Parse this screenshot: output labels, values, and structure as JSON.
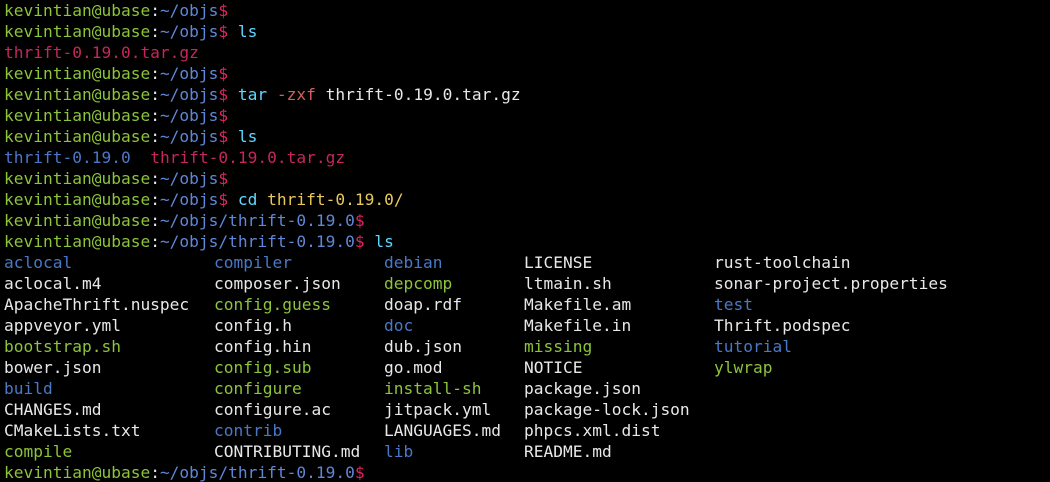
{
  "prompt": {
    "user_host": "kevintian@ubase",
    "separator": ":",
    "dollar": "$"
  },
  "history": [
    {
      "path": "~/objs",
      "command": null
    },
    {
      "path": "~/objs",
      "command": {
        "name": "ls",
        "args": []
      }
    },
    {
      "output": [
        {
          "text": "thrift-0.19.0.tar.gz",
          "type": "archive"
        }
      ]
    },
    {
      "path": "~/objs",
      "command": null
    },
    {
      "path": "~/objs",
      "command": {
        "name": "tar",
        "flag": "-zxf",
        "arg": "thrift-0.19.0.tar.gz"
      }
    },
    {
      "path": "~/objs",
      "command": null
    },
    {
      "path": "~/objs",
      "command": {
        "name": "ls",
        "args": []
      }
    },
    {
      "output": [
        {
          "text": "thrift-0.19.0",
          "type": "dir"
        },
        {
          "text": "thrift-0.19.0.tar.gz",
          "type": "archive"
        }
      ]
    },
    {
      "path": "~/objs",
      "command": null
    },
    {
      "path": "~/objs",
      "command": {
        "name": "cd",
        "arg": "thrift-0.19.0/"
      }
    },
    {
      "path": "~/objs/thrift-0.19.0",
      "command": null
    },
    {
      "path": "~/objs/thrift-0.19.0",
      "command": {
        "name": "ls",
        "args": []
      }
    }
  ],
  "lines": {
    "l0": {
      "path": "~/objs"
    },
    "l1": {
      "path": "~/objs",
      "cmd": "ls"
    },
    "l2": {
      "out": "thrift-0.19.0.tar.gz"
    },
    "l3": {
      "path": "~/objs"
    },
    "l4": {
      "path": "~/objs",
      "cmd": "tar",
      "flag": "-zxf",
      "arg": "thrift-0.19.0.tar.gz"
    },
    "l5": {
      "path": "~/objs"
    },
    "l6": {
      "path": "~/objs",
      "cmd": "ls"
    },
    "l7": {
      "out_dir": "thrift-0.19.0",
      "out_archive": "thrift-0.19.0.tar.gz"
    },
    "l8": {
      "path": "~/objs"
    },
    "l9": {
      "path": "~/objs",
      "cmd": "cd",
      "arg": "thrift-0.19.0/"
    },
    "l10": {
      "path": "~/objs/thrift-0.19.0"
    },
    "l11": {
      "path": "~/objs/thrift-0.19.0",
      "cmd": "ls"
    },
    "final": {
      "path": "~/objs/thrift-0.19.0"
    }
  },
  "listing": {
    "rows": [
      [
        {
          "name": "aclocal",
          "type": "dir"
        },
        {
          "name": "compiler",
          "type": "dir"
        },
        {
          "name": "debian",
          "type": "dir"
        },
        {
          "name": "LICENSE",
          "type": "file"
        },
        {
          "name": "rust-toolchain",
          "type": "file"
        }
      ],
      [
        {
          "name": "aclocal.m4",
          "type": "file"
        },
        {
          "name": "composer.json",
          "type": "file"
        },
        {
          "name": "depcomp",
          "type": "exec"
        },
        {
          "name": "ltmain.sh",
          "type": "file"
        },
        {
          "name": "sonar-project.properties",
          "type": "file"
        }
      ],
      [
        {
          "name": "ApacheThrift.nuspec",
          "type": "file"
        },
        {
          "name": "config.guess",
          "type": "exec"
        },
        {
          "name": "doap.rdf",
          "type": "file"
        },
        {
          "name": "Makefile.am",
          "type": "file"
        },
        {
          "name": "test",
          "type": "dir"
        }
      ],
      [
        {
          "name": "appveyor.yml",
          "type": "file"
        },
        {
          "name": "config.h",
          "type": "file"
        },
        {
          "name": "doc",
          "type": "dir"
        },
        {
          "name": "Makefile.in",
          "type": "file"
        },
        {
          "name": "Thrift.podspec",
          "type": "file"
        }
      ],
      [
        {
          "name": "bootstrap.sh",
          "type": "exec"
        },
        {
          "name": "config.hin",
          "type": "file"
        },
        {
          "name": "dub.json",
          "type": "file"
        },
        {
          "name": "missing",
          "type": "exec"
        },
        {
          "name": "tutorial",
          "type": "dir"
        }
      ],
      [
        {
          "name": "bower.json",
          "type": "file"
        },
        {
          "name": "config.sub",
          "type": "exec"
        },
        {
          "name": "go.mod",
          "type": "file"
        },
        {
          "name": "NOTICE",
          "type": "file"
        },
        {
          "name": "ylwrap",
          "type": "exec"
        }
      ],
      [
        {
          "name": "build",
          "type": "dir"
        },
        {
          "name": "configure",
          "type": "exec"
        },
        {
          "name": "install-sh",
          "type": "exec"
        },
        {
          "name": "package.json",
          "type": "file"
        },
        null
      ],
      [
        {
          "name": "CHANGES.md",
          "type": "file"
        },
        {
          "name": "configure.ac",
          "type": "file"
        },
        {
          "name": "jitpack.yml",
          "type": "file"
        },
        {
          "name": "package-lock.json",
          "type": "file"
        },
        null
      ],
      [
        {
          "name": "CMakeLists.txt",
          "type": "file"
        },
        {
          "name": "contrib",
          "type": "dir"
        },
        {
          "name": "LANGUAGES.md",
          "type": "file"
        },
        {
          "name": "phpcs.xml.dist",
          "type": "file"
        },
        null
      ],
      [
        {
          "name": "compile",
          "type": "exec"
        },
        {
          "name": "CONTRIBUTING.md",
          "type": "file"
        },
        {
          "name": "lib",
          "type": "dir"
        },
        {
          "name": "README.md",
          "type": "file"
        },
        null
      ]
    ]
  },
  "colors": {
    "background": "#000000",
    "user_host": "#8cc43a",
    "path": "#5f87d7",
    "dollar": "#e0245e",
    "command": "#5fd7ff",
    "flag": "#d75f5f",
    "archive": "#c4265f",
    "directory": "#4a78c8",
    "executable": "#8cc43a",
    "regular_file": "#e8e8e8"
  }
}
